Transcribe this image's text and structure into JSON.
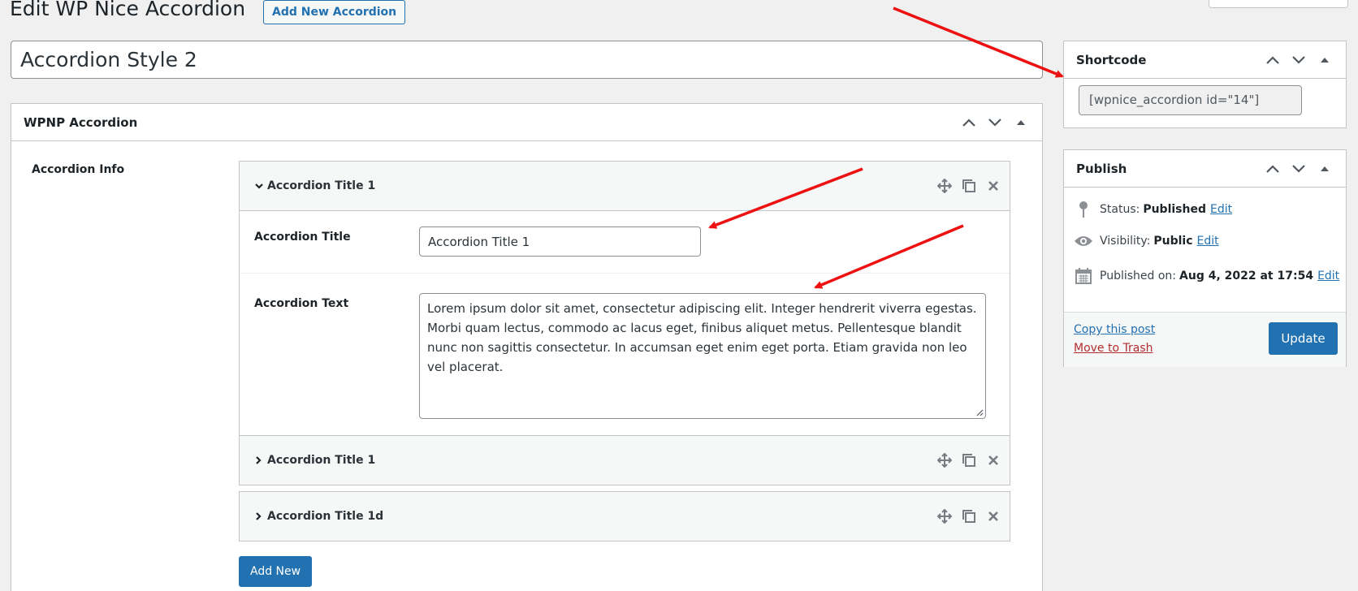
{
  "header": {
    "title": "Edit WP Nice Accordion",
    "add_new_label": "Add New Accordion"
  },
  "post": {
    "title": "Accordion Style 2"
  },
  "main_box": {
    "title": "WPNP Accordion",
    "section_label": "Accordion Info",
    "items": [
      {
        "title": "Accordion Title 1",
        "expanded": true,
        "fields": {
          "title_label": "Accordion Title",
          "title_value": "Accordion Title 1",
          "text_label": "Accordion Text",
          "text_value": "Lorem ipsum dolor sit amet, consectetur adipiscing elit. Integer hendrerit viverra egestas. Morbi quam lectus, commodo ac lacus eget, finibus aliquet metus. Pellentesque blandit nunc non sagittis consectetur. In accumsan eget enim eget porta. Etiam gravida non leo vel placerat."
        }
      },
      {
        "title": "Accordion Title 1",
        "expanded": false
      },
      {
        "title": "Accordion Title 1d",
        "expanded": false
      }
    ],
    "add_new_label": "Add New"
  },
  "shortcode": {
    "title": "Shortcode",
    "value": "[wpnice_accordion id=\"14\"]"
  },
  "publish": {
    "title": "Publish",
    "status_label": "Status:",
    "status_value": "Published",
    "status_edit": "Edit",
    "visibility_label": "Visibility:",
    "visibility_value": "Public",
    "visibility_edit": "Edit",
    "published_label": "Published on:",
    "published_value": "Aug 4, 2022 at 17:54",
    "published_edit": "Edit",
    "copy_label": "Copy this post",
    "trash_label": "Move to Trash",
    "update_label": "Update"
  },
  "colors": {
    "primary": "#2271b1",
    "danger": "#b32d2e",
    "annotation_arrow": "#ee1111",
    "background": "#f0f0f1"
  }
}
